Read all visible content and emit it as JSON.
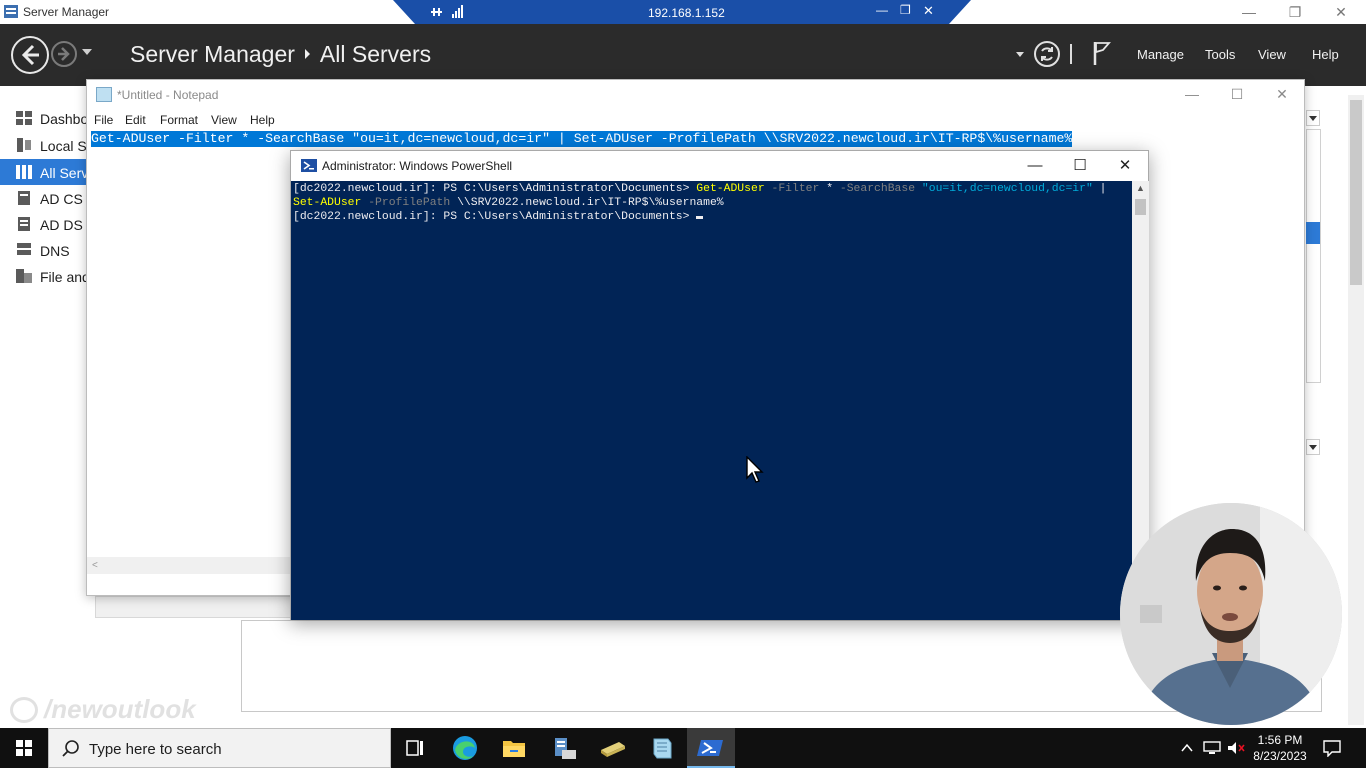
{
  "server_manager": {
    "window_title": "Server Manager",
    "breadcrumb_root": "Server Manager",
    "breadcrumb_current": "All Servers",
    "menus": [
      "Manage",
      "Tools",
      "View",
      "Help"
    ],
    "nav_items": [
      {
        "label": "Dashbo",
        "icon": "dashboard-icon"
      },
      {
        "label": "Local Se",
        "icon": "local-server-icon"
      },
      {
        "label": "All Serv",
        "icon": "all-servers-icon",
        "selected": true
      },
      {
        "label": "AD CS",
        "icon": "ad-cs-icon"
      },
      {
        "label": "AD DS",
        "icon": "ad-ds-icon"
      },
      {
        "label": "DNS",
        "icon": "dns-icon"
      },
      {
        "label": "File and",
        "icon": "file-storage-icon"
      }
    ]
  },
  "rdp_bar": {
    "host": "192.168.1.152"
  },
  "notepad": {
    "title": "*Untitled - Notepad",
    "menus": [
      "File",
      "Edit",
      "Format",
      "View",
      "Help"
    ],
    "selected_text": "Get-ADUser -Filter * -SearchBase \"ou=it,dc=newcloud,dc=ir\" | Set-ADUser -ProfilePath \\\\SRV2022.newcloud.ir\\IT-RP$\\%username%"
  },
  "powershell": {
    "title": "Administrator: Windows PowerShell",
    "prompt": "[dc2022.newcloud.ir]: PS C:\\Users\\Administrator\\Documents> ",
    "line1": {
      "cmd1": "Get-ADUser",
      "param1": " -Filter ",
      "star": "*",
      "param2": " -SearchBase ",
      "string1": "\"ou=it,dc=newcloud,dc=ir\"",
      "pipe": " |"
    },
    "line2": {
      "cmd2": "Set-ADUser",
      "param3": " -ProfilePath ",
      "path": "\\\\SRV2022.newcloud.ir\\IT-RP$\\%username%"
    }
  },
  "watermark": "/newoutlook",
  "taskbar": {
    "search_placeholder": "Type here to search",
    "time": "1:56 PM",
    "date": "8/23/2023",
    "apps": [
      "task-view-icon",
      "edge-icon",
      "file-explorer-icon",
      "server-manager-icon",
      "folder-icon",
      "notepad-icon",
      "powershell-icon"
    ]
  },
  "colors": {
    "selection": "#0078d7",
    "powershell_bg": "#012456",
    "ps_cmdlet": "#ffff00",
    "ps_parameter": "#808080",
    "ps_string": "#00abd9",
    "sm_header": "#2b2b2b",
    "rdp_bar": "#1a4fa8"
  }
}
